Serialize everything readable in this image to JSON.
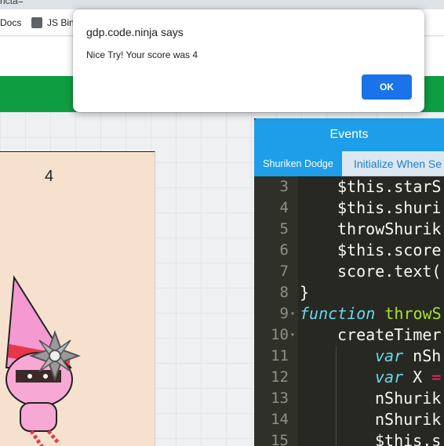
{
  "browser": {
    "title_fragment": "ncta=",
    "bookmarks": [
      {
        "label": "Docs",
        "icon": "docs-icon"
      },
      {
        "label": "JS Bin",
        "icon": "jsbin-icon"
      }
    ]
  },
  "dialog": {
    "title": "gdp.code.ninja says",
    "message": "Nice Try! Your score was 4",
    "ok_label": "OK"
  },
  "game": {
    "score": "4"
  },
  "events": {
    "header": "Events",
    "tabs": [
      {
        "label": "Shuriken Dodge",
        "active": true
      },
      {
        "label": "Initialize When Se",
        "active": false
      }
    ],
    "code_lines": [
      {
        "num": "3",
        "fold": false,
        "indent": 1,
        "text": "$this.starS"
      },
      {
        "num": "4",
        "fold": false,
        "indent": 1,
        "text": "$this.shuri"
      },
      {
        "num": "5",
        "fold": false,
        "indent": 1,
        "text": "throwShurik"
      },
      {
        "num": "6",
        "fold": false,
        "indent": 1,
        "text": "$this.score"
      },
      {
        "num": "7",
        "fold": false,
        "indent": 1,
        "text": "score.text("
      },
      {
        "num": "8",
        "fold": false,
        "indent": 0,
        "text": "}"
      },
      {
        "num": "9",
        "fold": true,
        "indent": 0,
        "text": "function throwS"
      },
      {
        "num": "10",
        "fold": true,
        "indent": 1,
        "text": "createTimer"
      },
      {
        "num": "11",
        "fold": false,
        "indent": 2,
        "text": "var nSh"
      },
      {
        "num": "12",
        "fold": false,
        "indent": 2,
        "text": "var X ="
      },
      {
        "num": "13",
        "fold": false,
        "indent": 2,
        "text": "nShurik"
      },
      {
        "num": "14",
        "fold": false,
        "indent": 2,
        "text": "nShurik"
      },
      {
        "num": "15",
        "fold": false,
        "indent": 2,
        "text": "$this.s"
      }
    ]
  },
  "colors": {
    "green_bar": "#0f9d42",
    "events_header": "#1e9ee8",
    "editor_bg": "#272822",
    "dialog_button": "#1a73e8"
  }
}
